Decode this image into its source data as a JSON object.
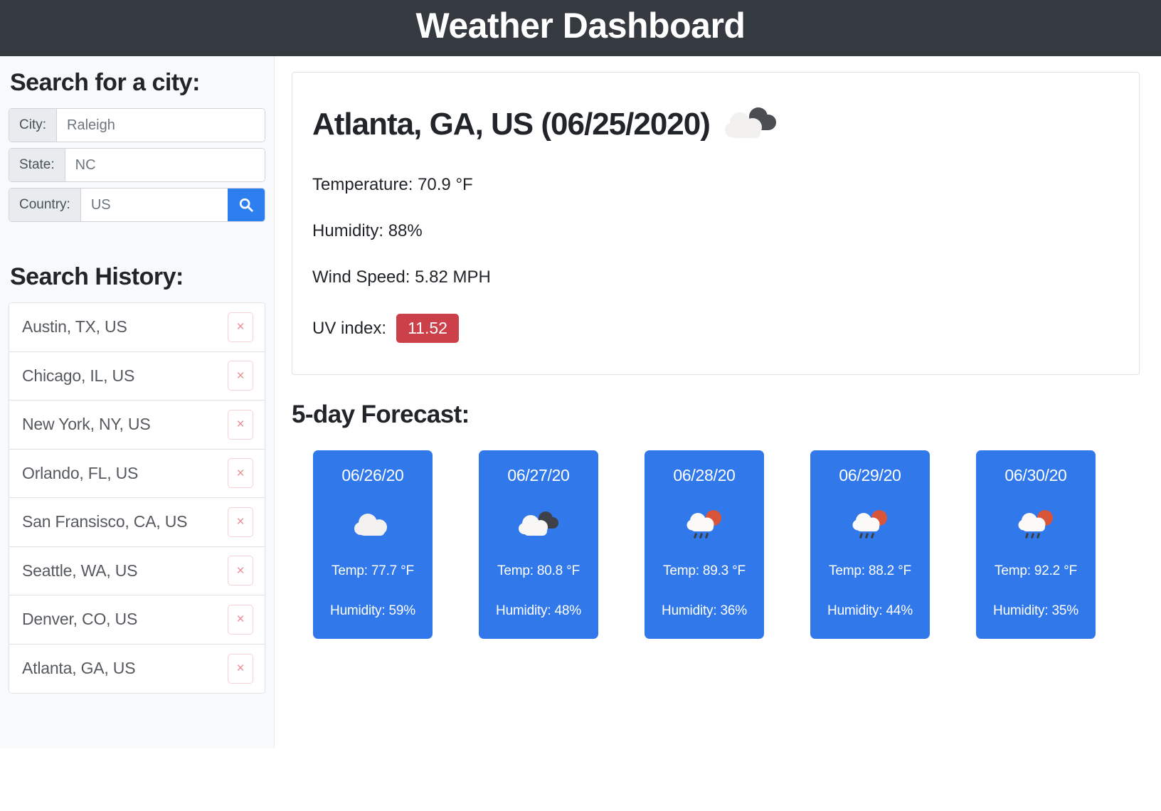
{
  "header": {
    "title": "Weather Dashboard",
    "bg_color": "#343a40"
  },
  "sidebar": {
    "search_heading": "Search for a city:",
    "form": {
      "city": {
        "label": "City:",
        "value": "",
        "placeholder": "Raleigh"
      },
      "state": {
        "label": "State:",
        "value": "",
        "placeholder": "NC"
      },
      "country": {
        "label": "Country:",
        "value": "",
        "placeholder": "US"
      },
      "search_icon": "search-icon",
      "search_button_color": "#2d7ff0"
    },
    "history_heading": "Search History:",
    "history": [
      {
        "label": "Austin, TX, US",
        "delete": "×"
      },
      {
        "label": "Chicago, IL, US",
        "delete": "×"
      },
      {
        "label": "New York, NY, US",
        "delete": "×"
      },
      {
        "label": "Orlando, FL, US",
        "delete": "×"
      },
      {
        "label": "San Fransisco, CA, US",
        "delete": "×"
      },
      {
        "label": "Seattle, WA, US",
        "delete": "×"
      },
      {
        "label": "Denver, CO, US",
        "delete": "×"
      },
      {
        "label": "Atlanta, GA, US",
        "delete": "×"
      }
    ]
  },
  "current": {
    "title": "Atlanta, GA, US (06/25/2020)",
    "icon": "broken-clouds-icon",
    "temperature": "Temperature: 70.9 °F",
    "humidity": "Humidity: 88%",
    "wind": "Wind Speed: 5.82 MPH",
    "uv_label": "UV index:",
    "uv_value": "11.52",
    "uv_badge_color": "#cc4049"
  },
  "forecast": {
    "heading": "5-day Forecast:",
    "card_color": "#3178ea",
    "days": [
      {
        "date": "06/26/20",
        "icon": "cloud-icon",
        "temp": "Temp: 77.7 °F",
        "humidity": "Humidity: 59%"
      },
      {
        "date": "06/27/20",
        "icon": "broken-clouds-icon",
        "temp": "Temp: 80.8 °F",
        "humidity": "Humidity: 48%"
      },
      {
        "date": "06/28/20",
        "icon": "sun-rain-cloud-icon",
        "temp": "Temp: 89.3 °F",
        "humidity": "Humidity: 36%"
      },
      {
        "date": "06/29/20",
        "icon": "sun-rain-cloud-icon",
        "temp": "Temp: 88.2 °F",
        "humidity": "Humidity: 44%"
      },
      {
        "date": "06/30/20",
        "icon": "sun-rain-cloud-icon",
        "temp": "Temp: 92.2 °F",
        "humidity": "Humidity: 35%"
      }
    ]
  }
}
